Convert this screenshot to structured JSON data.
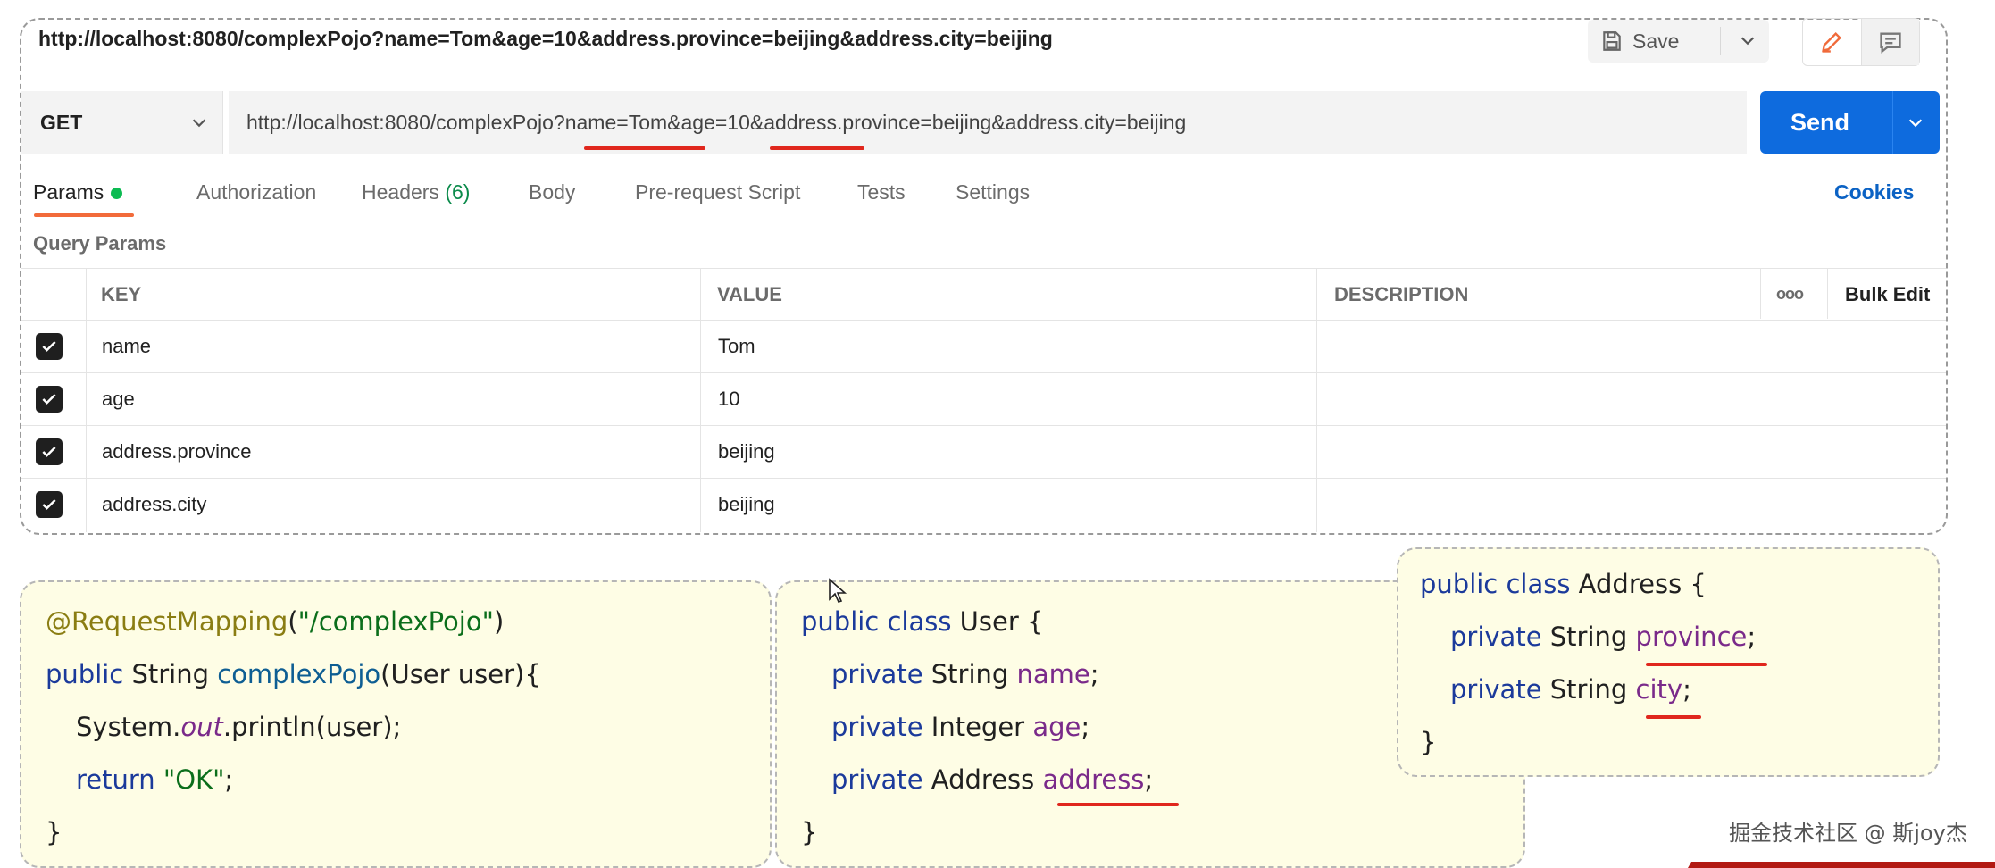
{
  "request": {
    "title_url": "http://localhost:8080/complexPojo?name=Tom&age=10&address.province=beijing&address.city=beijing",
    "method": "GET",
    "url_parts": {
      "prefix": "http://localhost:8080/complexPojo?name=Tom&age=10&",
      "province_key": "address.province",
      "province_val": "=beijing&",
      "city_key": "address.city",
      "city_val": "=beijing"
    },
    "save_label": "Save",
    "send_label": "Send"
  },
  "tabs": {
    "params": "Params",
    "authorization": "Authorization",
    "headers": "Headers",
    "headers_count": "(6)",
    "body": "Body",
    "prerequest": "Pre-request Script",
    "tests": "Tests",
    "settings": "Settings",
    "cookies": "Cookies"
  },
  "query_params": {
    "title": "Query Params",
    "columns": {
      "key": "KEY",
      "value": "VALUE",
      "description": "DESCRIPTION",
      "more": "ooo",
      "bulk_edit": "Bulk Edit"
    },
    "rows": [
      {
        "key": "name",
        "value": "Tom",
        "checked": true
      },
      {
        "key": "age",
        "value": "10",
        "checked": true
      },
      {
        "key": "address.province",
        "value": "beijing",
        "checked": true
      },
      {
        "key": "address.city",
        "value": "beijing",
        "checked": true
      }
    ]
  },
  "code": {
    "controller": {
      "annotation": "@RequestMapping",
      "annotation_open": "(",
      "annotation_arg": "\"/complexPojo\"",
      "annotation_close": ")",
      "l2_kw": "public",
      "l2_type": " String ",
      "l2_method": "complexPojo",
      "l2_params": "(User user){",
      "l3_a": "System.",
      "l3_static": "out",
      "l3_b": ".println(user);",
      "l4_kw": "return ",
      "l4_str": "\"OK\"",
      "l4_end": ";",
      "l5": "}"
    },
    "user": {
      "l1_kw": "public class",
      "l1_name": " User {",
      "l2_kw": "private",
      "l2_type": " String ",
      "l2_field": "name",
      "l3_kw": "private",
      "l3_type": " Integer ",
      "l3_field": "age",
      "l4_kw": "private",
      "l4_type": " Address ",
      "l4_field": "address",
      "semi": ";",
      "close": "}"
    },
    "address": {
      "l1_kw": "public class",
      "l1_name": " Address {",
      "l2_kw": "private",
      "l2_type": " String ",
      "l2_field": "province",
      "l3_kw": "private",
      "l3_type": " String ",
      "l3_field": "city",
      "semi": ";",
      "close": "}"
    }
  },
  "watermark": "掘金技术社区 @ 斯joy杰",
  "colors": {
    "send_blue": "#0e6bde",
    "active_tab_underline": "#f26b3a",
    "params_dot": "#0cbb52",
    "highlight_red": "#e0271d",
    "code_bg": "#fefde5"
  }
}
